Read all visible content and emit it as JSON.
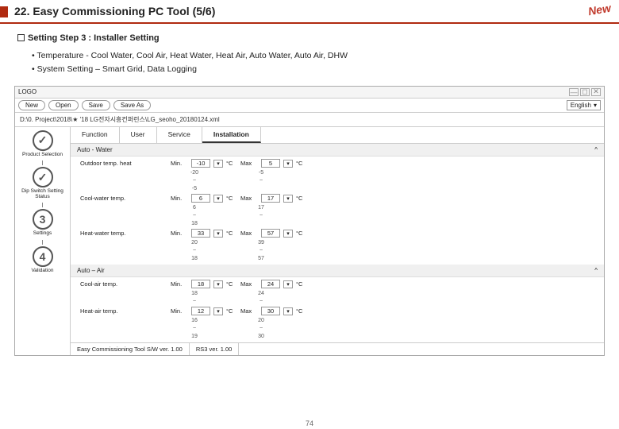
{
  "slide": {
    "title": "22. Easy Commissioning PC Tool (5/6)",
    "badge": "New",
    "page": "74",
    "section": "Setting Step 3 : Installer Setting",
    "bullet1": "• Temperature - Cool Water, Cool Air, Heat Water, Heat Air, Auto Water, Auto Air, DHW",
    "bullet2": "• System Setting – Smart Grid, Data Logging"
  },
  "app": {
    "logo": "LOGO",
    "toolbar": {
      "new": "New",
      "open": "Open",
      "save": "Save",
      "saveas": "Save As",
      "lang": "English"
    },
    "path": "D:\\0. Project\\2018\\★ '18 LG전자시흥컨퍼런스\\LG_seoho_20180124.xml",
    "tabs": {
      "t1": "Function",
      "t2": "User",
      "t3": "Service",
      "t4": "Installation"
    },
    "steps": {
      "s1": "Product Selection",
      "s2": "Dip Switch Setting Status",
      "s3n": "3",
      "s3": "Settings",
      "s4n": "4",
      "s4": "Validation"
    },
    "group1": "Auto - Water",
    "group2": "Auto – Air",
    "caret": "^",
    "labels": {
      "outdoor": "Outdoor temp. heat",
      "coolwater": "Cool-water temp.",
      "heatwater": "Heat-water temp.",
      "coolair": "Cool-air temp.",
      "heatair": "Heat-air temp.",
      "min": "Min.",
      "max": "Max",
      "degc": "°C",
      "tilde": "~"
    },
    "vals": {
      "outdoor": {
        "min": "-10",
        "minA": "-20",
        "minB": "-5",
        "max": "5",
        "maxA": "-5"
      },
      "coolwater": {
        "min": "6",
        "minA": "6",
        "minB": "18",
        "max": "17",
        "maxA": "17"
      },
      "heatwater": {
        "min": "33",
        "minA": "20",
        "minB": "18",
        "max": "57",
        "maxA": "39",
        "maxB": "57"
      },
      "coolair": {
        "min": "18",
        "minA": "18",
        "max": "24",
        "maxA": "24"
      },
      "heatair": {
        "min": "12",
        "minA": "16",
        "minB": "19",
        "max": "30",
        "maxA": "20",
        "maxB": "30"
      }
    },
    "footer": {
      "l": "Easy Commissioning Tool S/W ver. 1.00",
      "r": "RS3 ver. 1.00"
    }
  }
}
